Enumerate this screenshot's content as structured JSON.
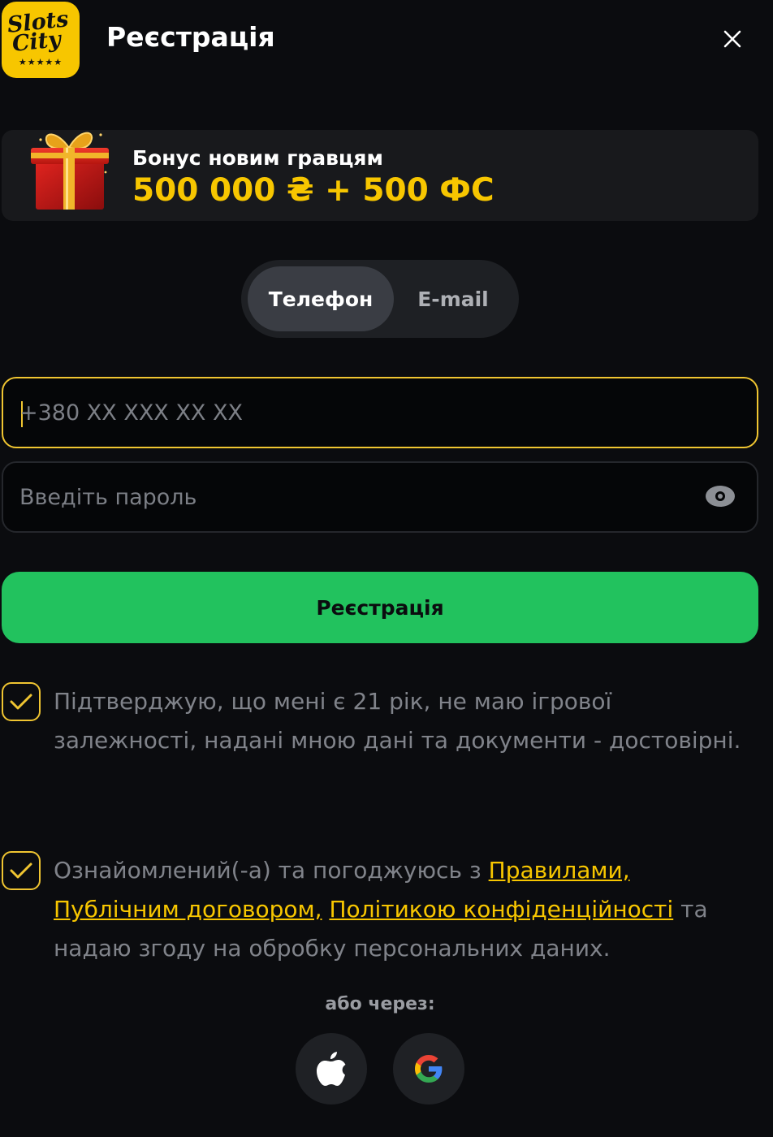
{
  "header": {
    "logo_line1": "Slots",
    "logo_line2": "City",
    "logo_stars": "★★★★★",
    "title": "Реєстрація"
  },
  "bonus": {
    "label": "Бонус новим гравцям",
    "amount": "500 000 ₴ + 500 ФС"
  },
  "tabs": [
    {
      "label": "Телефон",
      "active": true
    },
    {
      "label": "E-mail",
      "active": false
    }
  ],
  "form": {
    "phone_placeholder": "+380 XX XXX XX XX",
    "phone_value": "",
    "password_placeholder": "Введіть пароль",
    "password_value": "",
    "submit_label": "Реєстрація"
  },
  "consents": {
    "age": {
      "checked": true,
      "text": "Підтверджую, що мені є 21 рік, не маю ігрової залежності, надані мною дані та документи - достовірні."
    },
    "terms": {
      "checked": true,
      "prefix": "Ознайомлений(-а) та погоджуюсь з ",
      "link_rules": "Правилами,",
      "link_contract": "Публічним договором,",
      "link_privacy": "Політикою конфіденційності",
      "suffix": " та надаю згоду на обробку персональних даних."
    }
  },
  "social": {
    "or_label": "або через:",
    "providers": [
      "apple-icon",
      "google-icon"
    ]
  },
  "colors": {
    "accent_yellow": "#f7c600",
    "button_green": "#22c25e",
    "background": "#0b0c0f"
  }
}
